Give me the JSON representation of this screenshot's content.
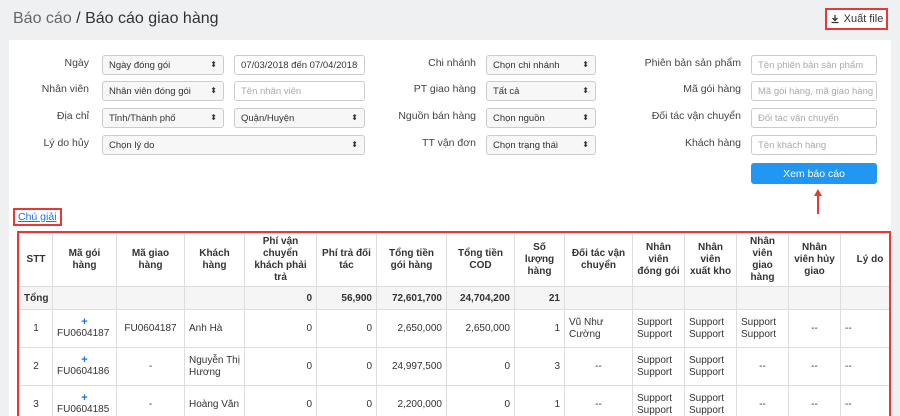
{
  "header": {
    "breadcrumb_parent": "Báo cáo",
    "separator": " / ",
    "title": "Báo cáo giao hàng",
    "export_label": "Xuất file",
    "export_icon": "download-icon"
  },
  "filters": {
    "ngay": {
      "label": "Ngày",
      "select": "Ngày đóng gói",
      "daterange": "07/03/2018 đến 07/04/2018"
    },
    "nhanvien": {
      "label": "Nhân viên",
      "select": "Nhân viên đóng gói",
      "placeholder": "Tên nhân viên"
    },
    "diachi": {
      "label": "Địa chỉ",
      "province": "Tỉnh/Thành phố",
      "district": "Quận/Huyện"
    },
    "lydohuy": {
      "label": "Lý do hủy",
      "select": "Chọn lý do"
    },
    "chinhanh": {
      "label": "Chi nhánh",
      "select": "Chọn chi nhánh"
    },
    "ptgiaohang": {
      "label": "PT giao hàng",
      "select": "Tất cả"
    },
    "nguonbanhang": {
      "label": "Nguồn bán hàng",
      "select": "Chọn nguồn"
    },
    "ttvandon": {
      "label": "TT vận đơn",
      "select": "Chọn trạng thái"
    },
    "phienban": {
      "label": "Phiên bản sản phẩm",
      "placeholder": "Tên phiên bản sản phẩm"
    },
    "magoihang": {
      "label": "Mã gói hàng",
      "placeholder": "Mã gói hàng, mã giao hàng"
    },
    "doitac": {
      "label": "Đối tác vận chuyển",
      "placeholder": "Đối tác vận chuyển"
    },
    "khachhang": {
      "label": "Khách hàng",
      "placeholder": "Tên khách hàng"
    },
    "view_button": "Xem báo cáo"
  },
  "legend_link": "Chú giải",
  "table": {
    "columns": [
      "STT",
      "Mã gói hàng",
      "Mã giao hàng",
      "Khách hàng",
      "Phí vận chuyển khách phải trả",
      "Phí trả đối tác",
      "Tổng tiền gói hàng",
      "Tổng tiền COD",
      "Số lượng hàng",
      "Đối tác vận chuyển",
      "Nhân viên đóng gói",
      "Nhân viên xuất kho",
      "Nhân viên giao hàng",
      "Nhân viên hủy giao",
      "Lý do"
    ],
    "total": {
      "label": "Tổng",
      "phi_vc": "0",
      "phi_doitac": "56,900",
      "tong_tien": "72,601,700",
      "tong_cod": "24,704,200",
      "so_luong": "21"
    },
    "rows": [
      {
        "stt": "1",
        "plus": "+",
        "ma_goi": "FU0604187",
        "ma_giao": "FU0604187",
        "khach": "Anh Hà",
        "phi_vc": "0",
        "phi_doitac": "0",
        "tong_tien": "2,650,000",
        "cod": "2,650,000",
        "sl": "1",
        "doitac": "Vũ Như Cường",
        "nv_dong": "Support Support",
        "nv_xuat": "Support Support",
        "nv_giao": "Support Support",
        "nv_huy": "--",
        "lydo": "--"
      },
      {
        "stt": "2",
        "plus": "+",
        "ma_goi": "FU0604186",
        "ma_giao": "-",
        "khach": "Nguyễn Thị Hương",
        "phi_vc": "0",
        "phi_doitac": "0",
        "tong_tien": "24,997,500",
        "cod": "0",
        "sl": "3",
        "doitac": "--",
        "nv_dong": "Support Support",
        "nv_xuat": "Support Support",
        "nv_giao": "--",
        "nv_huy": "--",
        "lydo": "--"
      },
      {
        "stt": "3",
        "plus": "+",
        "ma_goi": "FU0604185",
        "ma_giao": "-",
        "khach": "Hoàng Văn",
        "phi_vc": "0",
        "phi_doitac": "0",
        "tong_tien": "2,200,000",
        "cod": "0",
        "sl": "1",
        "doitac": "--",
        "nv_dong": "Support Support",
        "nv_xuat": "Support Support",
        "nv_giao": "--",
        "nv_huy": "--",
        "lydo": "--"
      }
    ]
  },
  "colors": {
    "accent": "#2196f3",
    "highlight": "#e53935",
    "link": "#1a73e8"
  }
}
